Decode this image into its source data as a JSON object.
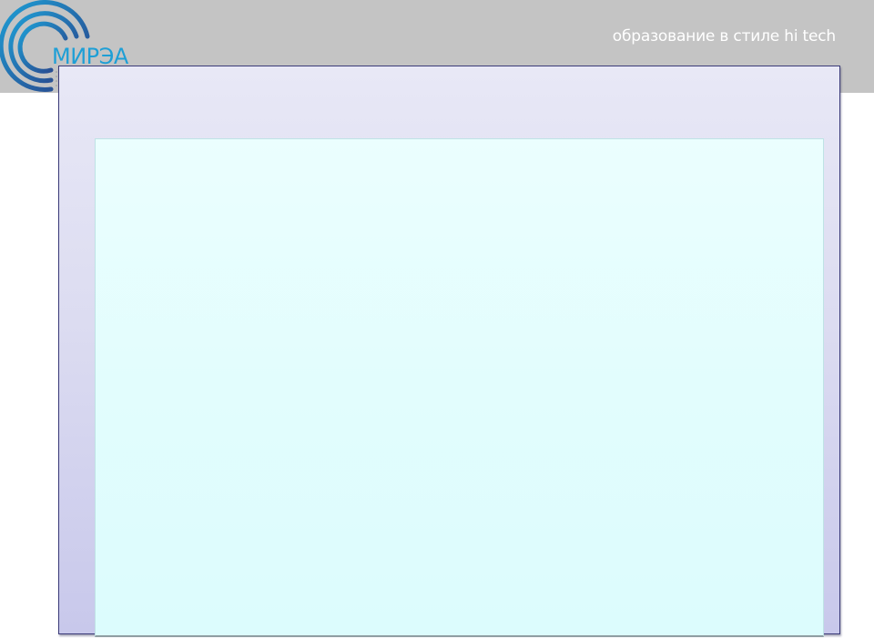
{
  "header": {
    "logo_text": "МИРЭА",
    "tagline": "образование в стиле hi tech"
  },
  "colors": {
    "header_band": "#c4c4c4",
    "logo_ring_dark": "#2a3f86",
    "logo_ring_light": "#1e9fd6",
    "outer_panel": "#dcdcf1",
    "outer_border": "#3a3a78",
    "inner_panel": "#e2fdfd"
  },
  "icons": {
    "logo": "concentric-rings-logo-icon"
  }
}
